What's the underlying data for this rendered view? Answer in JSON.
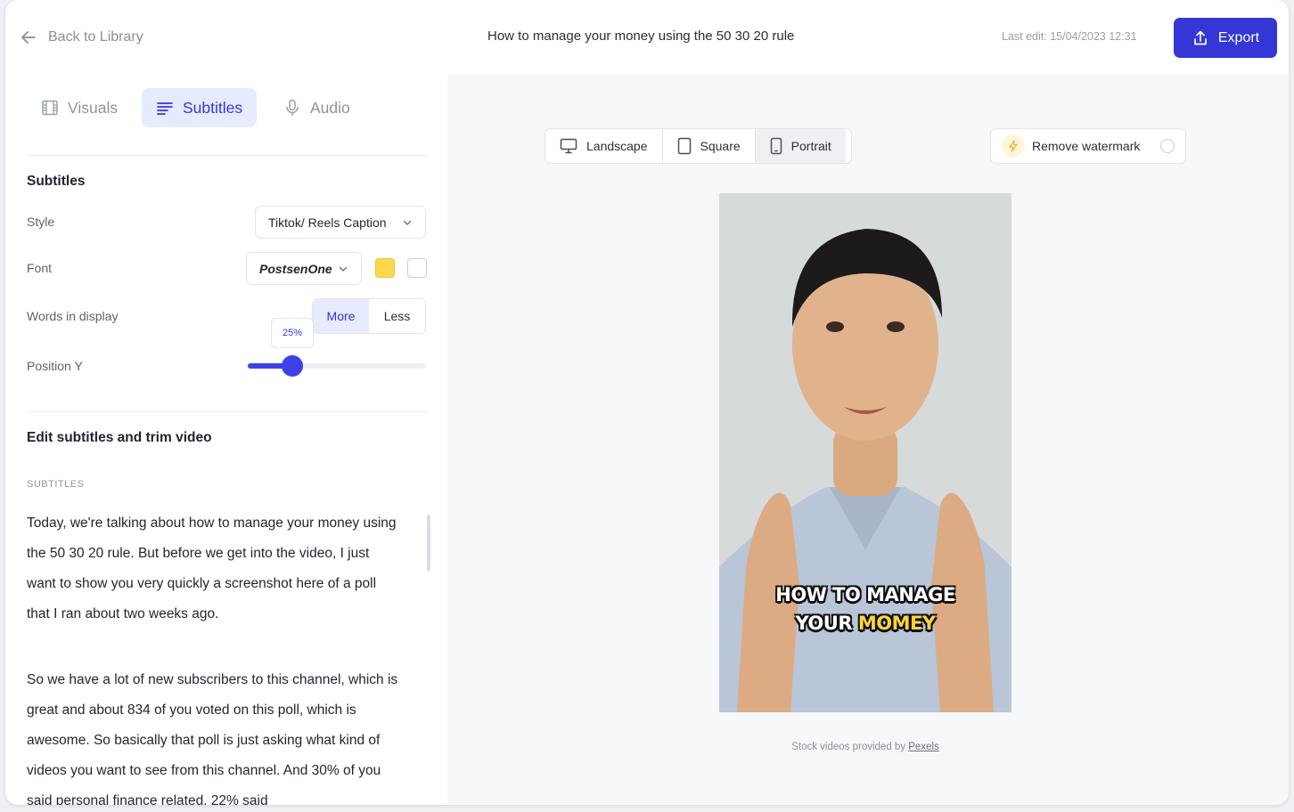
{
  "header": {
    "back_label": "Back to Library",
    "title": "How to manage your money using the 50 30 20 rule",
    "last_edit": "Last edit: 15/04/2023 12:31",
    "export_label": "Export"
  },
  "tabs": [
    {
      "label": "Visuals",
      "icon": "film-icon",
      "active": false
    },
    {
      "label": "Subtitles",
      "icon": "lines-icon",
      "active": true
    },
    {
      "label": "Audio",
      "icon": "microphone-icon",
      "active": false
    }
  ],
  "subtitles_settings": {
    "section_title": "Subtitles",
    "style_label": "Style",
    "style_value": "Tiktok/ Reels Caption",
    "font_label": "Font",
    "font_value": "PostsenOne",
    "font_color_primary": "#fcd94a",
    "font_color_secondary": "#ffffff",
    "words_label": "Words in display",
    "words_options": [
      "More",
      "Less"
    ],
    "words_selected": "More",
    "position_label": "Position Y",
    "position_value": "25%",
    "position_fraction": 0.25
  },
  "edit": {
    "section_title": "Edit subtitles and trim video",
    "subtitles_caption": "SUBTITLES",
    "paragraphs": [
      "Today, we're talking about how to manage your money using the 50 30 20 rule. But before we get into the video, I just want to show you very quickly a screenshot here of a poll that I ran about two weeks ago.",
      "So we have a lot of new subscribers to this channel, which is great and about 834 of you voted on this poll, which is awesome. So basically that poll is just asking what kind of videos you want to see from this channel. And 30% of you said personal finance related, 22% said"
    ]
  },
  "preview": {
    "orientations": [
      {
        "label": "Landscape",
        "icon": "monitor-icon",
        "selected": false
      },
      {
        "label": "Square",
        "icon": "square-device-icon",
        "selected": false
      },
      {
        "label": "Portrait",
        "icon": "phone-icon",
        "selected": true
      }
    ],
    "watermark_label": "Remove watermark",
    "caption_line1": "HOW TO MANAGE",
    "caption_line2_a": "YOUR",
    "caption_line2_b": "MOMEY",
    "credit_text": "Stock videos provided by",
    "credit_link": "Pexels"
  },
  "colors": {
    "accent": "#3437d6",
    "accent_light": "#e6ebff",
    "caption_highlight": "#ffd43b"
  }
}
